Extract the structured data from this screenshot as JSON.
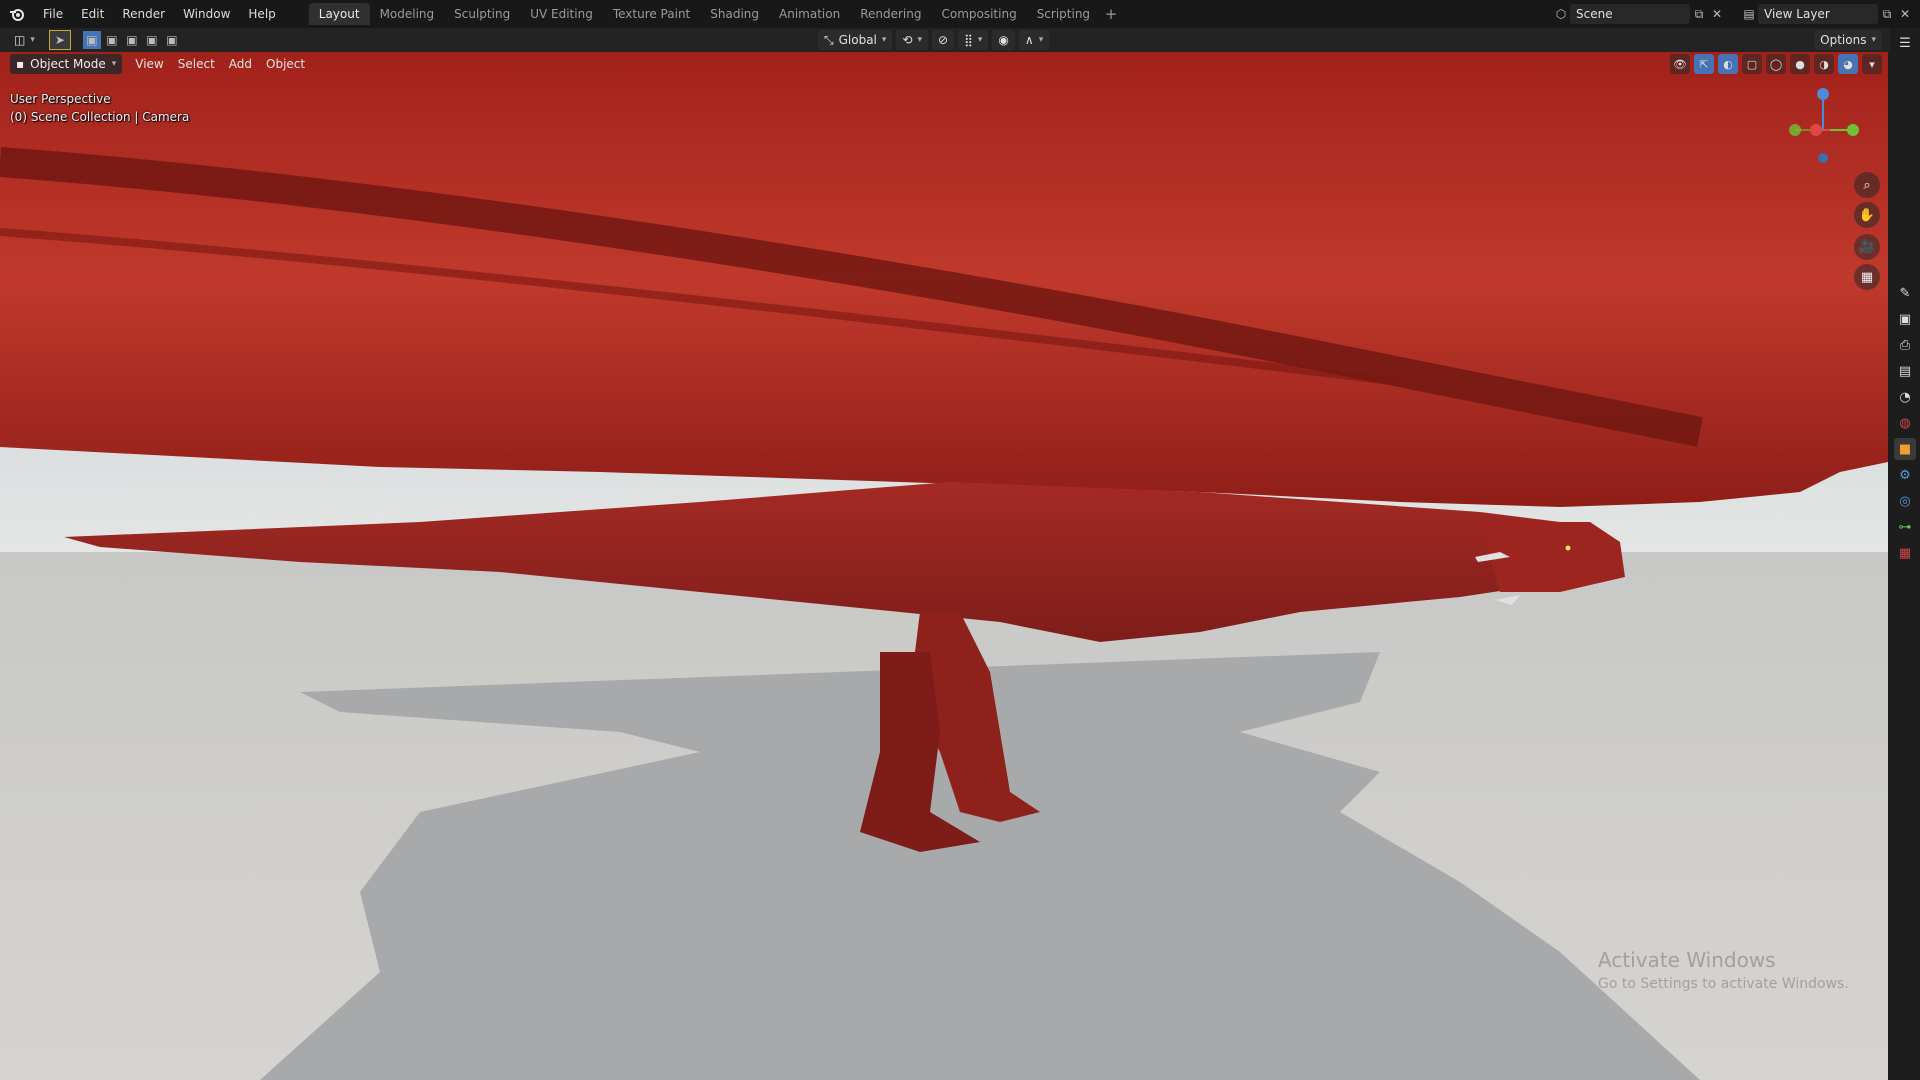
{
  "app": {
    "logo_icon": "blender-logo-icon"
  },
  "menu": [
    "File",
    "Edit",
    "Render",
    "Window",
    "Help"
  ],
  "workspaces": [
    "Layout",
    "Modeling",
    "Sculpting",
    "UV Editing",
    "Texture Paint",
    "Shading",
    "Animation",
    "Rendering",
    "Compositing",
    "Scripting"
  ],
  "active_workspace": "Layout",
  "scene": {
    "name": "Scene"
  },
  "view_layer": {
    "name": "View Layer"
  },
  "header": {
    "transform_orientation": "Global",
    "options_label": "Options"
  },
  "viewport": {
    "mode": "Object Mode",
    "menus": [
      "View",
      "Select",
      "Add",
      "Object"
    ],
    "view_name": "User Perspective",
    "collection_info": "(0) Scene Collection | Camera",
    "gizmo": {
      "x": "X",
      "y": "Y",
      "z": "Z"
    },
    "watermark_line1": "Activate Windows",
    "watermark_line2": "Go to Settings to activate Windows."
  },
  "colors": {
    "accent": "#4772b3",
    "dragon_red": "#b02a22",
    "ground": "#cfcfcf"
  }
}
